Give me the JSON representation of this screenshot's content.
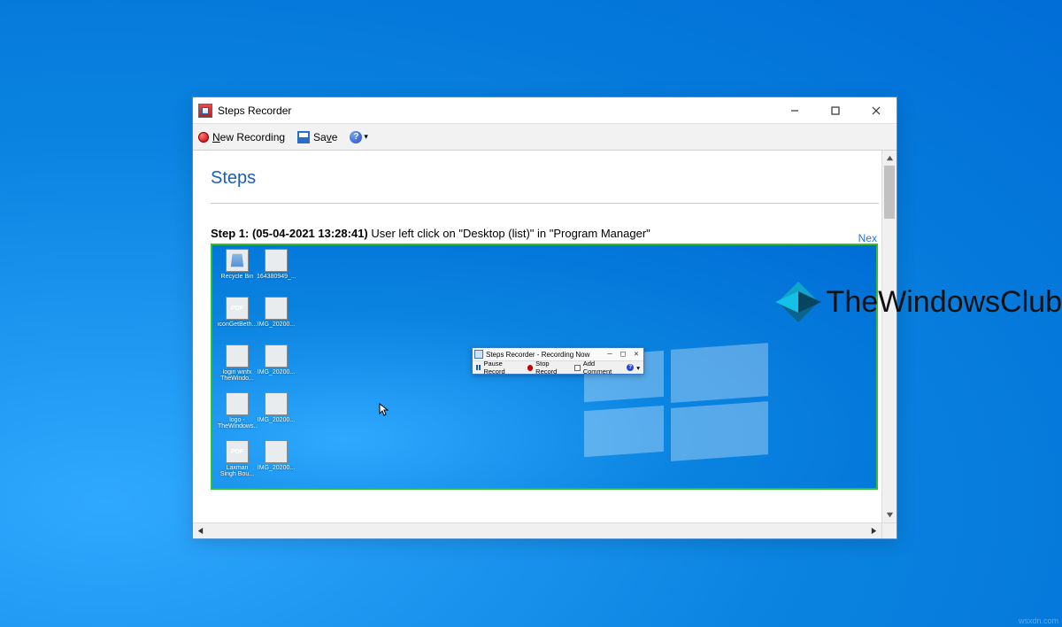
{
  "window": {
    "title": "Steps Recorder",
    "toolbar": {
      "new_recording": "New Recording",
      "save": "Save",
      "help_symbol": "?"
    }
  },
  "content": {
    "heading": "Steps",
    "next_link": "Nex",
    "step1_prefix": "Step 1: (05-04-2021 13:28:41) ",
    "step1_desc": "User left click on \"Desktop (list)\" in \"Program Manager\""
  },
  "screenshot": {
    "mini_window": {
      "title": "Steps Recorder - Recording Now",
      "pause": "Pause Record",
      "stop": "Stop Record",
      "add_comment": "Add Comment"
    },
    "desktop_icons": [
      {
        "label": "Recycle Bin",
        "kind": "recycle"
      },
      {
        "label": "164380949_...",
        "kind": "grey"
      },
      {
        "label": "iconGetBeth...",
        "kind": "pdf"
      },
      {
        "label": "IMG_20200...",
        "kind": "grey"
      },
      {
        "label": "login winfx TheWindo...",
        "kind": "grey"
      },
      {
        "label": "IMG_20200...",
        "kind": "grey"
      },
      {
        "label": "logo - TheWindows...",
        "kind": "grey"
      },
      {
        "label": "IMG_20200...",
        "kind": "grey"
      },
      {
        "label": "Laxman Singh Bou...",
        "kind": "pdf"
      },
      {
        "label": "IMG_20200...",
        "kind": "grey"
      }
    ]
  },
  "watermark": {
    "text": "TheWindowsClub"
  },
  "footer": {
    "credit": "wsxdn.com"
  }
}
